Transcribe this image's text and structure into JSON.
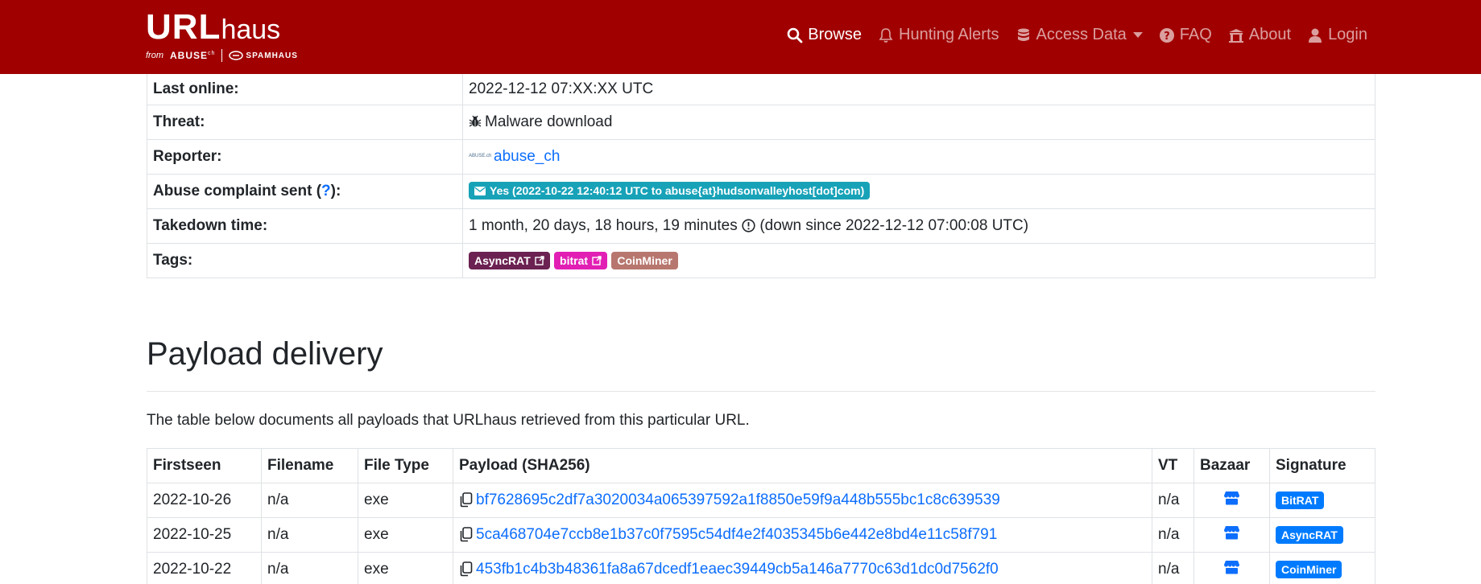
{
  "brand": {
    "name_bold": "URL",
    "name_light": "haus",
    "from": "from",
    "abuse": "ABUSE",
    "abuse_sup": "ch",
    "spamhaus": "SPAMHAUS"
  },
  "nav": {
    "browse": "Browse",
    "hunting": "Hunting Alerts",
    "access": "Access Data",
    "faq": "FAQ",
    "about": "About",
    "login": "Login"
  },
  "info": {
    "last_online_label": "Last online:",
    "last_online_value": "2022-12-12 07:XX:XX UTC",
    "threat_label": "Threat:",
    "threat_value": "Malware download",
    "reporter_label": "Reporter:",
    "reporter_value": "abuse_ch",
    "reporter_logo": "ABUSE.ch",
    "complaint_label_pre": "Abuse complaint sent (",
    "complaint_help": "?",
    "complaint_label_post": "):",
    "complaint_value": "Yes (2022-10-22 12:40:12 UTC to abuse{at}hudsonvalleyhost[dot]com)",
    "takedown_label": "Takedown time:",
    "takedown_duration": "1 month, 20 days, 18 hours, 19 minutes",
    "takedown_since": "(down since 2022-12-12 07:00:08 UTC)",
    "tags_label": "Tags:",
    "tags": [
      "AsyncRAT",
      "bitrat",
      "CoinMiner"
    ]
  },
  "section": {
    "title": "Payload delivery",
    "description": "The table below documents all payloads that URLhaus retrieved from this particular URL."
  },
  "payload_table": {
    "headers": [
      "Firstseen",
      "Filename",
      "File Type",
      "Payload (SHA256)",
      "VT",
      "Bazaar",
      "Signature"
    ],
    "rows": [
      {
        "firstseen": "2022-10-26",
        "filename": "n/a",
        "filetype": "exe",
        "sha256": "bf7628695c2df7a3020034a065397592a1f8850e59f9a448b555bc1c8c639539",
        "vt": "n/a",
        "signature": "BitRAT"
      },
      {
        "firstseen": "2022-10-25",
        "filename": "n/a",
        "filetype": "exe",
        "sha256": "5ca468704e7ccb8e1b37c0f7595c54df4e2f4035345b6e442e8bd4e11c58f791",
        "vt": "n/a",
        "signature": "AsyncRAT"
      },
      {
        "firstseen": "2022-10-22",
        "filename": "n/a",
        "filetype": "exe",
        "sha256": "453fb1c4b3b48361fa8a67dcedf1eaec39449cb5a146a7770c63d1dc0d7562f0",
        "vt": "n/a",
        "signature": "CoinMiner"
      }
    ]
  },
  "colors": {
    "navbar": "#a00000",
    "link": "#0d6efd",
    "complaint_badge": "#17a2b8",
    "tag_asyncrat": "#6b2151",
    "tag_bitrat": "#e21fb4",
    "tag_coinminer": "#b7776e",
    "signature_badge": "#007bff"
  },
  "icons": [
    "search-icon",
    "bell-icon",
    "database-icon",
    "question-circle-icon",
    "building-icon",
    "user-icon",
    "bug-icon",
    "envelope-icon",
    "external-link-icon",
    "exclamation-circle-icon",
    "copy-icon",
    "store-icon"
  ]
}
